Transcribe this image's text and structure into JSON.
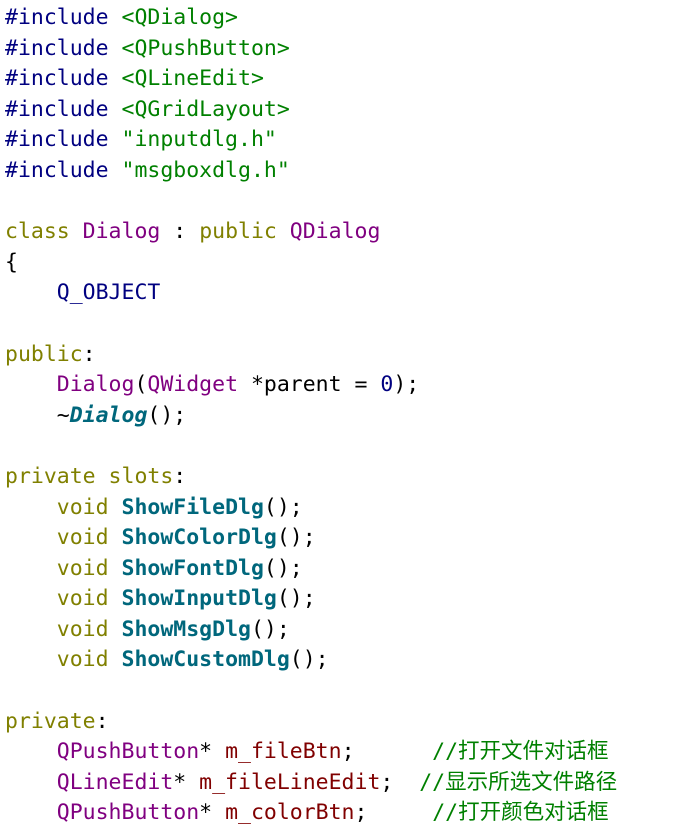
{
  "code_view": {
    "lines": [
      {
        "tokens": [
          {
            "t": "#include ",
            "k": "directive"
          },
          {
            "t": "<QDialog>",
            "k": "include"
          }
        ]
      },
      {
        "tokens": [
          {
            "t": "#include ",
            "k": "directive"
          },
          {
            "t": "<QPushButton>",
            "k": "include"
          }
        ]
      },
      {
        "tokens": [
          {
            "t": "#include ",
            "k": "directive"
          },
          {
            "t": "<QLineEdit>",
            "k": "include"
          }
        ]
      },
      {
        "tokens": [
          {
            "t": "#include ",
            "k": "directive"
          },
          {
            "t": "<QGridLayout>",
            "k": "include"
          }
        ]
      },
      {
        "tokens": [
          {
            "t": "#include ",
            "k": "directive"
          },
          {
            "t": "\"inputdlg.h\"",
            "k": "include"
          }
        ]
      },
      {
        "tokens": [
          {
            "t": "#include ",
            "k": "directive"
          },
          {
            "t": "\"msgboxdlg.h\"",
            "k": "include"
          }
        ]
      },
      {
        "tokens": []
      },
      {
        "tokens": [
          {
            "t": "class ",
            "k": "keyword"
          },
          {
            "t": "Dialog",
            "k": "type"
          },
          {
            "t": " : ",
            "k": "plain"
          },
          {
            "t": "public ",
            "k": "keyword"
          },
          {
            "t": "QDialog",
            "k": "type"
          }
        ]
      },
      {
        "tokens": [
          {
            "t": "{",
            "k": "plain"
          }
        ]
      },
      {
        "tokens": [
          {
            "t": "    ",
            "k": "plain"
          },
          {
            "t": "Q_OBJECT",
            "k": "macro"
          }
        ]
      },
      {
        "tokens": []
      },
      {
        "tokens": [
          {
            "t": "public",
            "k": "keyword"
          },
          {
            "t": ":",
            "k": "plain"
          }
        ]
      },
      {
        "tokens": [
          {
            "t": "    ",
            "k": "plain"
          },
          {
            "t": "Dialog",
            "k": "type"
          },
          {
            "t": "(",
            "k": "plain"
          },
          {
            "t": "QWidget",
            "k": "type"
          },
          {
            "t": " *parent = ",
            "k": "plain"
          },
          {
            "t": "0",
            "k": "number"
          },
          {
            "t": ");",
            "k": "plain"
          }
        ]
      },
      {
        "tokens": [
          {
            "t": "    ~",
            "k": "plain"
          },
          {
            "t": "Dialog",
            "k": "method-it"
          },
          {
            "t": "();",
            "k": "plain"
          }
        ]
      },
      {
        "tokens": []
      },
      {
        "tokens": [
          {
            "t": "private slots",
            "k": "keyword"
          },
          {
            "t": ":",
            "k": "plain"
          }
        ]
      },
      {
        "tokens": [
          {
            "t": "    ",
            "k": "plain"
          },
          {
            "t": "void ",
            "k": "keyword"
          },
          {
            "t": "ShowFileDlg",
            "k": "method"
          },
          {
            "t": "();",
            "k": "plain"
          }
        ]
      },
      {
        "tokens": [
          {
            "t": "    ",
            "k": "plain"
          },
          {
            "t": "void ",
            "k": "keyword"
          },
          {
            "t": "ShowColorDlg",
            "k": "method"
          },
          {
            "t": "();",
            "k": "plain"
          }
        ]
      },
      {
        "tokens": [
          {
            "t": "    ",
            "k": "plain"
          },
          {
            "t": "void ",
            "k": "keyword"
          },
          {
            "t": "ShowFontDlg",
            "k": "method"
          },
          {
            "t": "();",
            "k": "plain"
          }
        ]
      },
      {
        "tokens": [
          {
            "t": "    ",
            "k": "plain"
          },
          {
            "t": "void ",
            "k": "keyword"
          },
          {
            "t": "ShowInputDlg",
            "k": "method"
          },
          {
            "t": "();",
            "k": "plain"
          }
        ]
      },
      {
        "tokens": [
          {
            "t": "    ",
            "k": "plain"
          },
          {
            "t": "void ",
            "k": "keyword"
          },
          {
            "t": "ShowMsgDlg",
            "k": "method"
          },
          {
            "t": "();",
            "k": "plain"
          }
        ]
      },
      {
        "tokens": [
          {
            "t": "    ",
            "k": "plain"
          },
          {
            "t": "void ",
            "k": "keyword"
          },
          {
            "t": "ShowCustomDlg",
            "k": "method"
          },
          {
            "t": "();",
            "k": "plain"
          }
        ]
      },
      {
        "tokens": []
      },
      {
        "tokens": [
          {
            "t": "private",
            "k": "keyword"
          },
          {
            "t": ":",
            "k": "plain"
          }
        ]
      },
      {
        "tokens": [
          {
            "t": "    ",
            "k": "plain"
          },
          {
            "t": "QPushButton",
            "k": "type"
          },
          {
            "t": "* ",
            "k": "plain"
          },
          {
            "t": "m_fileBtn",
            "k": "member"
          },
          {
            "t": ";      ",
            "k": "plain"
          },
          {
            "t": "//打开文件对话框",
            "k": "comment"
          }
        ]
      },
      {
        "tokens": [
          {
            "t": "    ",
            "k": "plain"
          },
          {
            "t": "QLineEdit",
            "k": "type"
          },
          {
            "t": "* ",
            "k": "plain"
          },
          {
            "t": "m_fileLineEdit",
            "k": "member"
          },
          {
            "t": ";  ",
            "k": "plain"
          },
          {
            "t": "//显示所选文件路径",
            "k": "comment"
          }
        ]
      },
      {
        "tokens": [
          {
            "t": "    ",
            "k": "plain"
          },
          {
            "t": "QPushButton",
            "k": "type"
          },
          {
            "t": "* ",
            "k": "plain"
          },
          {
            "t": "m_colorBtn",
            "k": "member"
          },
          {
            "t": ";     ",
            "k": "plain"
          },
          {
            "t": "//打开颜色对话框",
            "k": "comment"
          }
        ]
      }
    ]
  },
  "colors": {
    "background": "#ffffff",
    "directive": "#000080",
    "include_path": "#008000",
    "keyword": "#808000",
    "type": "#800080",
    "macro": "#000080",
    "number": "#000080",
    "method": "#00677c",
    "member": "#800000",
    "comment": "#008000",
    "plain": "#000000"
  }
}
